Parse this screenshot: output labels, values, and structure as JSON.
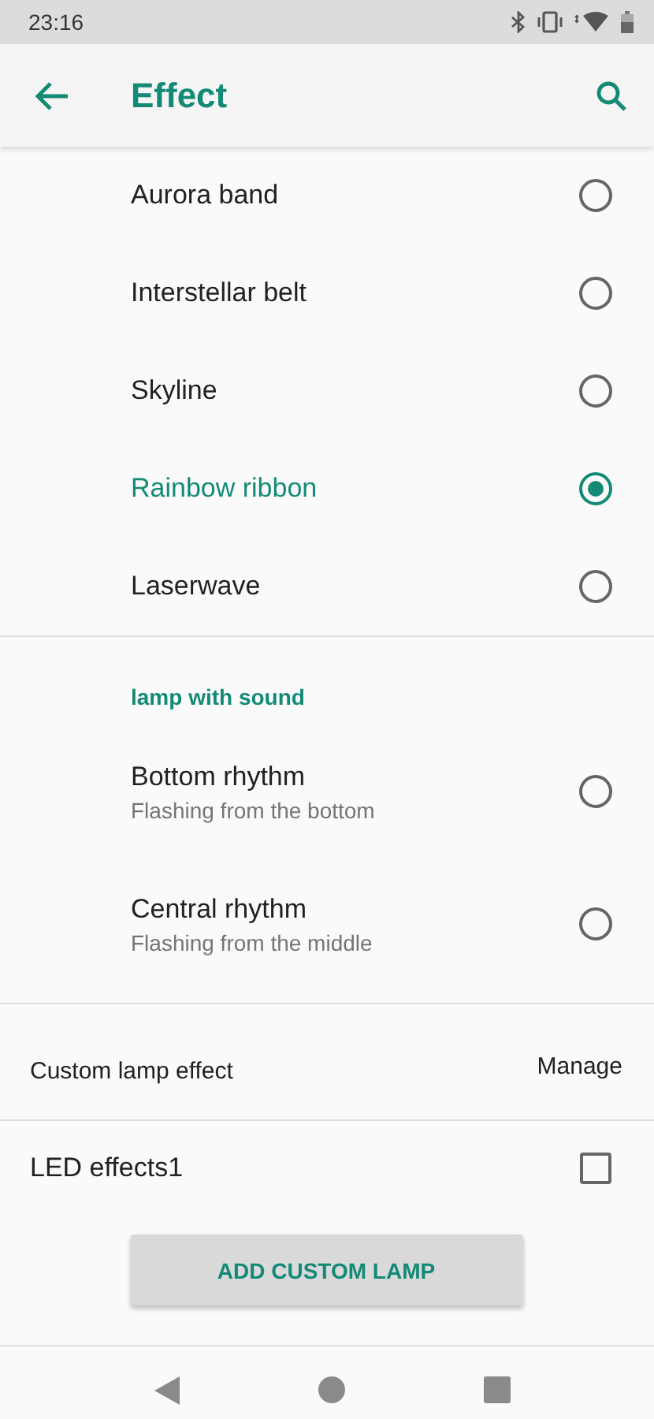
{
  "status_bar": {
    "time": "23:16"
  },
  "app_bar": {
    "title": "Effect"
  },
  "effects": [
    {
      "label": "Aurora band",
      "selected": false
    },
    {
      "label": "Interstellar belt",
      "selected": false
    },
    {
      "label": "Skyline",
      "selected": false
    },
    {
      "label": "Rainbow ribbon",
      "selected": true
    },
    {
      "label": "Laserwave",
      "selected": false
    }
  ],
  "sound_section": {
    "header": "lamp with sound",
    "items": [
      {
        "label": "Bottom rhythm",
        "summary": "Flashing from the bottom",
        "selected": false
      },
      {
        "label": "Central rhythm",
        "summary": "Flashing from the middle",
        "selected": false
      }
    ]
  },
  "custom": {
    "label": "Custom lamp effect",
    "action": "Manage"
  },
  "custom_effects": [
    {
      "label": "LED effects1",
      "checked": false
    }
  ],
  "add_button": "ADD CUSTOM LAMP"
}
